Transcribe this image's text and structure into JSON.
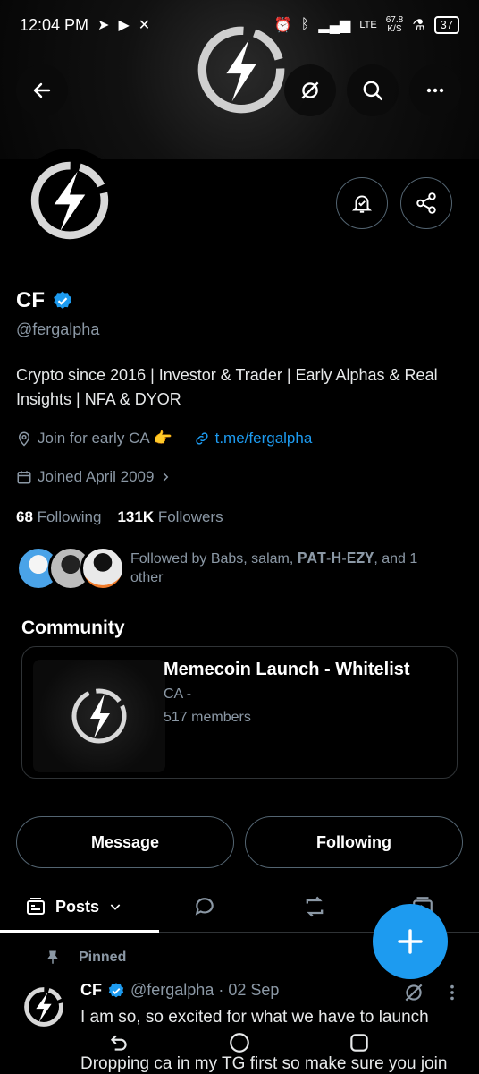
{
  "status": {
    "time": "12:04 PM",
    "net_speed": "67.8",
    "net_unit": "K/S",
    "network": "LTE",
    "battery": "37"
  },
  "icons": {
    "back": "arrow-left-icon",
    "grok": "grok-icon",
    "search": "search-icon",
    "more": "more-horizontal-icon",
    "notify": "bell-plus-icon",
    "share": "share-icon",
    "verified": "verified-badge-icon",
    "location": "location-pin-icon",
    "link": "link-icon",
    "calendar": "calendar-icon",
    "posts": "posts-icon",
    "replies": "reply-bubble-icon",
    "reposts": "repost-icon",
    "media": "media-icon",
    "compose": "plus-icon",
    "pin": "pin-icon"
  },
  "profile": {
    "name": "CF",
    "handle": "@fergalpha",
    "bio": "Crypto since 2016 | Investor & Trader | Early Alphas & Real Insights | NFA & DYOR",
    "location": "Join for early CA 👉",
    "link": "t.me/fergalpha",
    "joined": "Joined April 2009",
    "following_count": "68",
    "following_label": "Following",
    "followers_count": "131K",
    "followers_label": "Followers",
    "followed_by": "Followed by Babs, salam, 𝐏𝐀𝐓-𝐇-𝐄𝐙𝐘, and 1 other"
  },
  "community": {
    "section_title": "Community",
    "name": "Memecoin Launch - Whitelist",
    "sub": "CA -",
    "members": "517 members"
  },
  "actions": {
    "message": "Message",
    "following": "Following"
  },
  "tabs": {
    "posts": "Posts"
  },
  "pinned_post": {
    "pinned_label": "Pinned",
    "author": "CF",
    "handle_date": "@fergalpha · 02 Sep",
    "line1": "I am so, so excited for what we have to launch",
    "line2": "Dropping ca in my TG first so make sure you join"
  },
  "colors": {
    "accent": "#1d9bf0",
    "muted": "#8b98a5",
    "border": "#2f3336"
  }
}
